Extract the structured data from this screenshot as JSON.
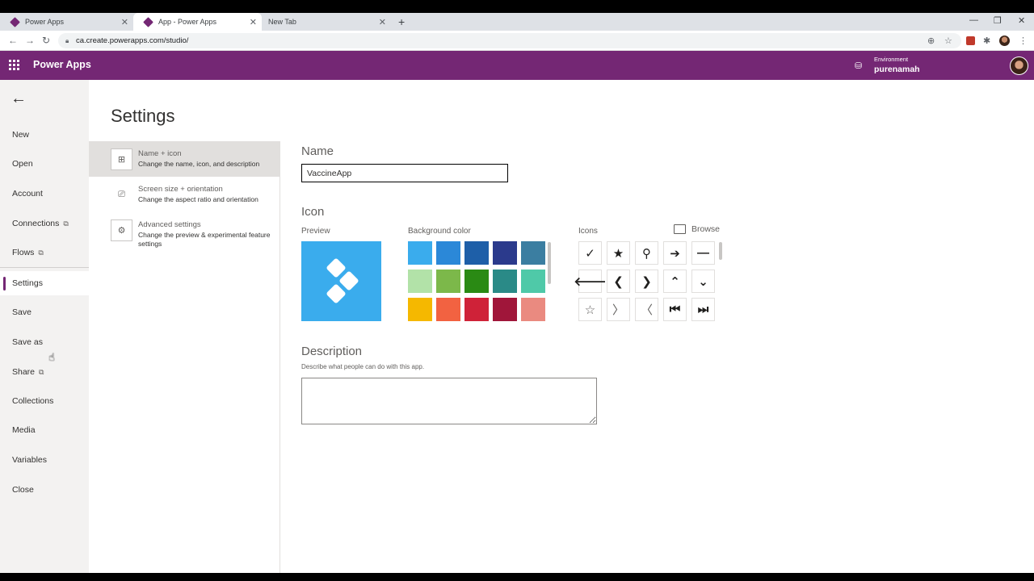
{
  "browser": {
    "tabs": [
      {
        "label": "Power Apps"
      },
      {
        "label": "App - Power Apps"
      },
      {
        "label": "New Tab"
      }
    ],
    "url": "ca.create.powerapps.com/studio/"
  },
  "appbar": {
    "title": "Power Apps",
    "environment_label": "Environment",
    "environment_name": "purenamah"
  },
  "leftnav": {
    "items": [
      {
        "label": "New"
      },
      {
        "label": "Open"
      },
      {
        "label": "Account"
      },
      {
        "label": "Connections"
      },
      {
        "label": "Flows"
      },
      {
        "label": "Settings"
      },
      {
        "label": "Save"
      },
      {
        "label": "Save as"
      },
      {
        "label": "Share"
      },
      {
        "label": "Collections"
      },
      {
        "label": "Media"
      },
      {
        "label": "Variables"
      },
      {
        "label": "Close"
      }
    ],
    "active": "Settings"
  },
  "page": {
    "title": "Settings"
  },
  "settings_list": [
    {
      "title": "Name + icon",
      "desc": "Change the name, icon, and description"
    },
    {
      "title": "Screen size + orientation",
      "desc": "Change the aspect ratio and orientation"
    },
    {
      "title": "Advanced settings",
      "desc": "Change the preview & experimental feature settings"
    }
  ],
  "form": {
    "name_label": "Name",
    "name_value": "VaccineApp",
    "icon_label": "Icon",
    "preview_label": "Preview",
    "bg_color_label": "Background color",
    "icons_label": "Icons",
    "browse_label": "Browse",
    "description_label": "Description",
    "description_hint": "Describe what people can do with this app.",
    "description_value": ""
  },
  "colors": {
    "accent": "#742774",
    "preview_bg": "#3aaced",
    "swatches": [
      "#3aaced",
      "#2b88d8",
      "#1e5fa8",
      "#2b3a8c",
      "#3b7ea1",
      "#b2e2a8",
      "#7cb84a",
      "#2a8a14",
      "#2a8a87",
      "#4fc9a8",
      "#f5b800",
      "#f26241",
      "#cf2238",
      "#a0163a",
      "#ea8a80"
    ]
  },
  "icons": [
    {
      "name": "check-icon",
      "glyph": "✓"
    },
    {
      "name": "star-filled-icon",
      "glyph": "★"
    },
    {
      "name": "search-icon",
      "glyph": "⚲"
    },
    {
      "name": "arrow-right-icon",
      "glyph": "➔"
    },
    {
      "name": "minus-icon",
      "glyph": "—"
    },
    {
      "name": "arrow-left-icon",
      "glyph": "🡐"
    },
    {
      "name": "chevron-left-bold-icon",
      "glyph": "❮"
    },
    {
      "name": "chevron-right-bold-icon",
      "glyph": "❯"
    },
    {
      "name": "chevron-up-icon",
      "glyph": "⌃"
    },
    {
      "name": "chevron-down-icon",
      "glyph": "⌄"
    },
    {
      "name": "star-outline-icon",
      "glyph": "☆"
    },
    {
      "name": "chevron-right-thin-icon",
      "glyph": "〉"
    },
    {
      "name": "chevron-left-thin-icon",
      "glyph": "〈"
    },
    {
      "name": "first-page-icon",
      "glyph": "⏮"
    },
    {
      "name": "last-page-icon",
      "glyph": "⏭"
    }
  ]
}
